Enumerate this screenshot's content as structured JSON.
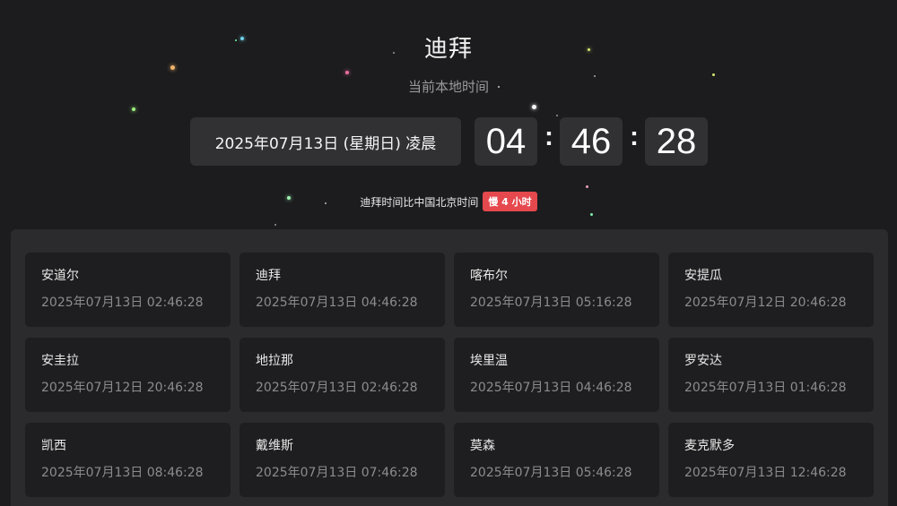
{
  "city": "迪拜",
  "subtitle": "当前本地时间",
  "date_text": "2025年07月13日 (星期日) 凌晨",
  "time": {
    "hours": "04",
    "minutes": "46",
    "seconds": "28",
    "separator": ":"
  },
  "diff": {
    "text": "迪拜时间比中国北京时间",
    "badge": "慢 4 小时"
  },
  "colors": {
    "background": "#1c1c1e",
    "panel": "#2b2b2d",
    "card": "#1e1e20",
    "badge": "#e5484d"
  },
  "cities": [
    {
      "name": "安道尔",
      "time": "2025年07月13日 02:46:28"
    },
    {
      "name": "迪拜",
      "time": "2025年07月13日 04:46:28"
    },
    {
      "name": "喀布尔",
      "time": "2025年07月13日 05:16:28"
    },
    {
      "name": "安提瓜",
      "time": "2025年07月12日 20:46:28"
    },
    {
      "name": "安圭拉",
      "time": "2025年07月12日 20:46:28"
    },
    {
      "name": "地拉那",
      "time": "2025年07月13日 02:46:28"
    },
    {
      "name": "埃里温",
      "time": "2025年07月13日 04:46:28"
    },
    {
      "name": "罗安达",
      "time": "2025年07月13日 01:46:28"
    },
    {
      "name": "凯西",
      "time": "2025年07月13日 08:46:28"
    },
    {
      "name": "戴维斯",
      "time": "2025年07月13日 07:46:28"
    },
    {
      "name": "莫森",
      "time": "2025年07月13日 05:46:28"
    },
    {
      "name": "麦克默多",
      "time": "2025年07月13日 12:46:28"
    }
  ]
}
